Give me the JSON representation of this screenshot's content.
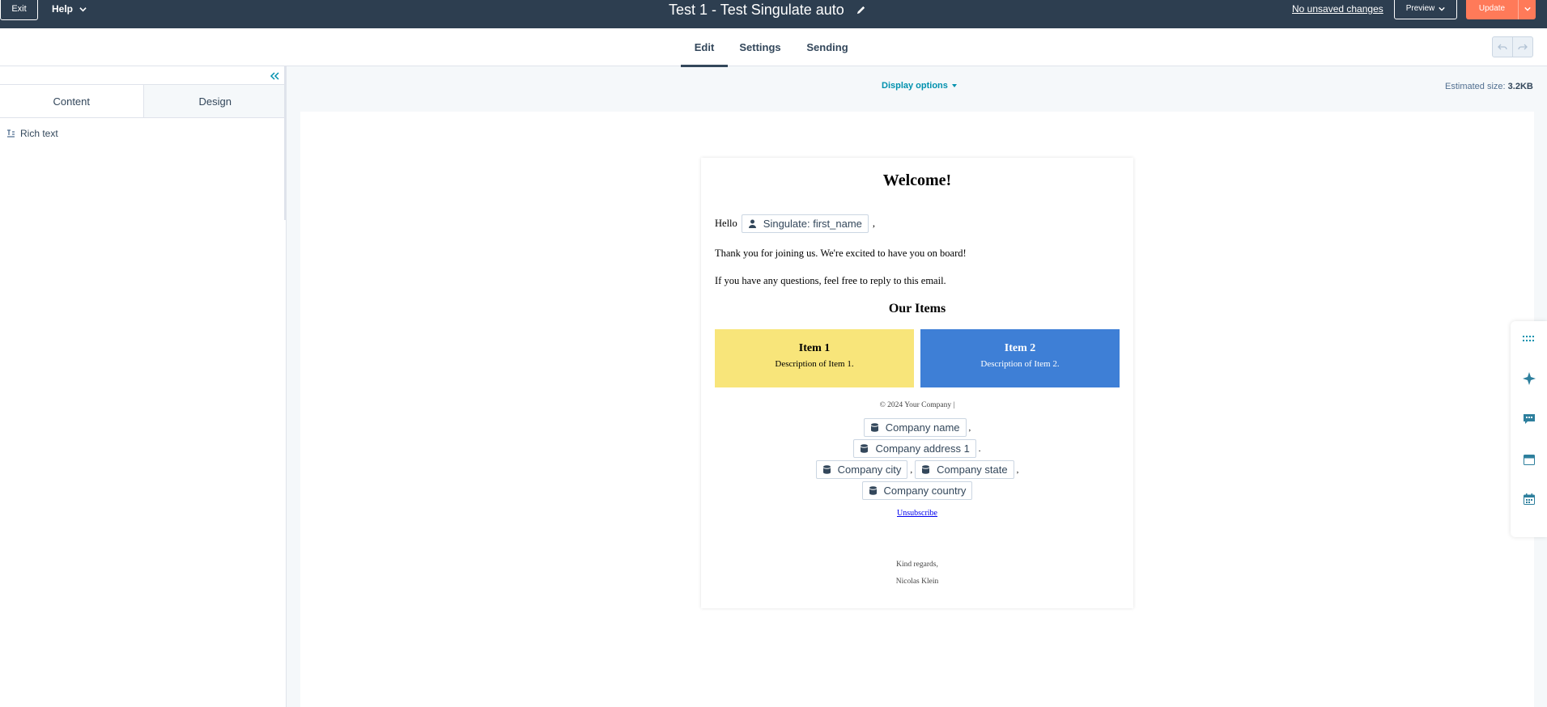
{
  "topbar": {
    "exit_label": "Exit",
    "help_label": "Help",
    "title": "Test 1 - Test Singulate auto",
    "unsaved_label": "No unsaved changes",
    "preview_label": "Preview",
    "update_label": "Update"
  },
  "nav": {
    "tabs": [
      {
        "label": "Edit",
        "active": true
      },
      {
        "label": "Settings",
        "active": false
      },
      {
        "label": "Sending",
        "active": false
      }
    ]
  },
  "left_panel": {
    "tabs": [
      {
        "label": "Content",
        "active": true
      },
      {
        "label": "Design",
        "active": false
      }
    ],
    "modules": [
      {
        "label": "Rich text",
        "icon": "rich-text-icon"
      }
    ]
  },
  "canvas": {
    "display_options_label": "Display options",
    "estimated_size_label": "Estimated size:",
    "estimated_size_value": "3.2KB"
  },
  "email": {
    "heading": "Welcome!",
    "greeting": "Hello",
    "greeting_token": "Singulate: first_name",
    "greeting_suffix": ",",
    "para1": "Thank you for joining us. We're excited to have you on board!",
    "para2": "If you have any questions, feel free to reply to this email.",
    "items_heading": "Our Items",
    "items": [
      {
        "title": "Item 1",
        "description": "Description of Item 1.",
        "color": "#f8e57a"
      },
      {
        "title": "Item 2",
        "description": "Description of Item 2.",
        "color": "#3e7fd6"
      }
    ],
    "footer_copyright": "© 2024 Your Company |",
    "tokens": {
      "company_name": "Company name",
      "company_address": "Company address 1",
      "company_city": "Company city",
      "company_state": "Company state",
      "company_country": "Company country"
    },
    "sep_comma": ",",
    "sep_dot": ".",
    "unsubscribe": "Unsubscribe",
    "sign_off": "Kind regards,",
    "signature": "Nicolas Klein"
  },
  "right_rail": {
    "icons": [
      "grid-icon",
      "sparkle-icon",
      "comment-icon",
      "layout-icon",
      "calendar-icon"
    ]
  },
  "colors": {
    "topbar": "#2d3e50",
    "accent": "#ff7a59",
    "link": "#0091ae"
  }
}
